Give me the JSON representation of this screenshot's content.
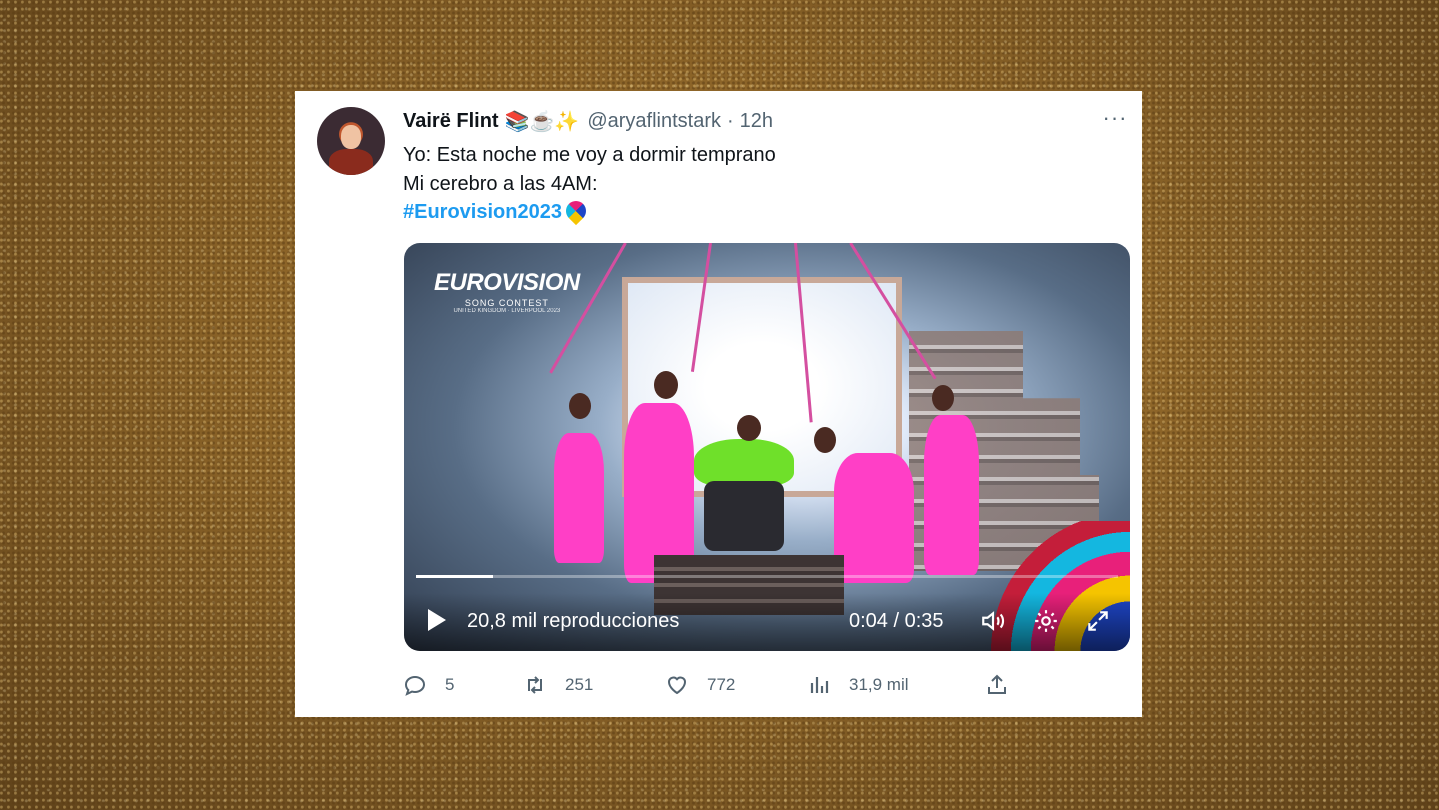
{
  "tweet": {
    "author_name": "Vairë Flint",
    "author_emojis": "📚☕✨",
    "handle": "@aryaflintstark",
    "separator": "·",
    "time": "12h",
    "more_label": "···",
    "text_lines": [
      "Yo: Esta noche me voy a dormir temprano",
      "Mi cerebro a las 4AM:"
    ],
    "hashtag": "#Eurovision2023"
  },
  "video": {
    "logo_main": "EUROVISION",
    "logo_sub": "SONG CONTEST",
    "logo_tiny": "UNITED KINGDOM · LIVERPOOL 2023",
    "views": "20,8 mil reproducciones",
    "timecode": "0:04 / 0:35",
    "progress": 0.11
  },
  "actions": {
    "replies": "5",
    "retweets": "251",
    "likes": "772",
    "views": "31,9 mil"
  },
  "icons": {
    "play": "play-icon",
    "volume": "volume-icon",
    "settings": "gear-icon",
    "fullscreen": "expand-icon",
    "reply": "reply-icon",
    "retweet": "retweet-icon",
    "like": "heart-icon",
    "analytics": "bar-chart-icon",
    "share": "share-icon"
  },
  "colors": {
    "accent": "#1d9bf0",
    "text": "#0f1419",
    "secondary": "#536471",
    "background": "#8c6428"
  }
}
